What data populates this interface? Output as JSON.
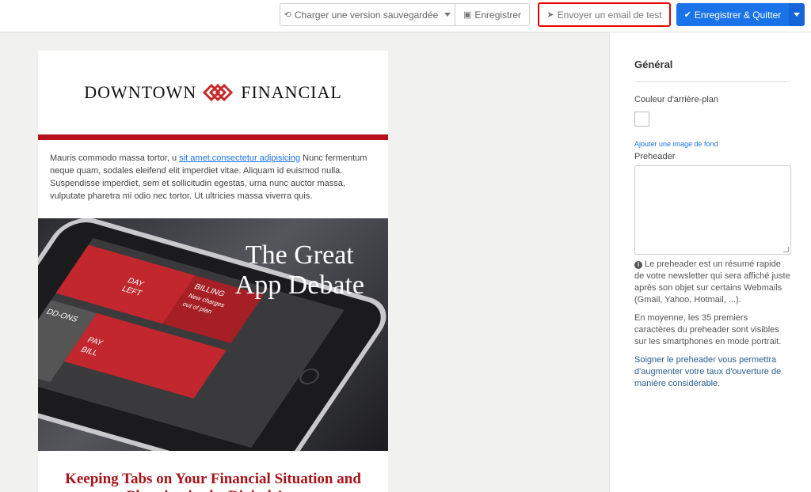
{
  "toolbar": {
    "load_label": "Charger une version sauvegardée",
    "save_label": "Enregistrer",
    "test_label": "Envoyer un email de test",
    "savequit_label": "Enregistrer & Quitter"
  },
  "email": {
    "logo_left": "DOWNTOWN",
    "logo_right": "FINANCIAL",
    "intro_before": "Mauris commodo massa tortor, u ",
    "intro_link": "sit amet,consectetur adipisicing",
    "intro_after": " Nunc fermentum neque quam, sodales eleifend elit imperdiet vitae. Aliquam id euismod nulla. Suspendisse imperdiet, sem et sollicitudin egestas, urna nunc auctor massa, vulputate pharetra mi odio nec tortor. Ut ultricies massa viverra quis.",
    "hero_line1": "The Great",
    "hero_line2": "App Debate",
    "hero_tiles": {
      "billing": "BILLING",
      "new_charges": "New charges",
      "out_of_plan": "out of plan",
      "addons": "DD-ONS",
      "pay": "PAY",
      "bill": "BILL",
      "day": "DAY",
      "left": "LEFT"
    },
    "heading": "Keeping Tabs on Your Financial Situation and Planning in the Digital Age"
  },
  "panel": {
    "title": "Général",
    "bg_color_label": "Couleur d'arrière-plan",
    "add_bg_image": "Ajouter une image de fond",
    "preheader_label": "Preheader",
    "help1": "Le preheader est un résumé rapide de votre newsletter qui sera affiché juste après son objet sur certains Webmails (Gmail, Yahoo, Hotmail, ...).",
    "help2": "En moyenne, les 35 premiers caractères du preheader sont visibles sur les smartphones en mode portrait.",
    "help3": "Soigner le preheader vous permettra d'augmenter votre taux d'ouverture de manière considérable."
  },
  "colors": {
    "accent_blue": "#1a73e8",
    "brand_red": "#b5121b"
  }
}
